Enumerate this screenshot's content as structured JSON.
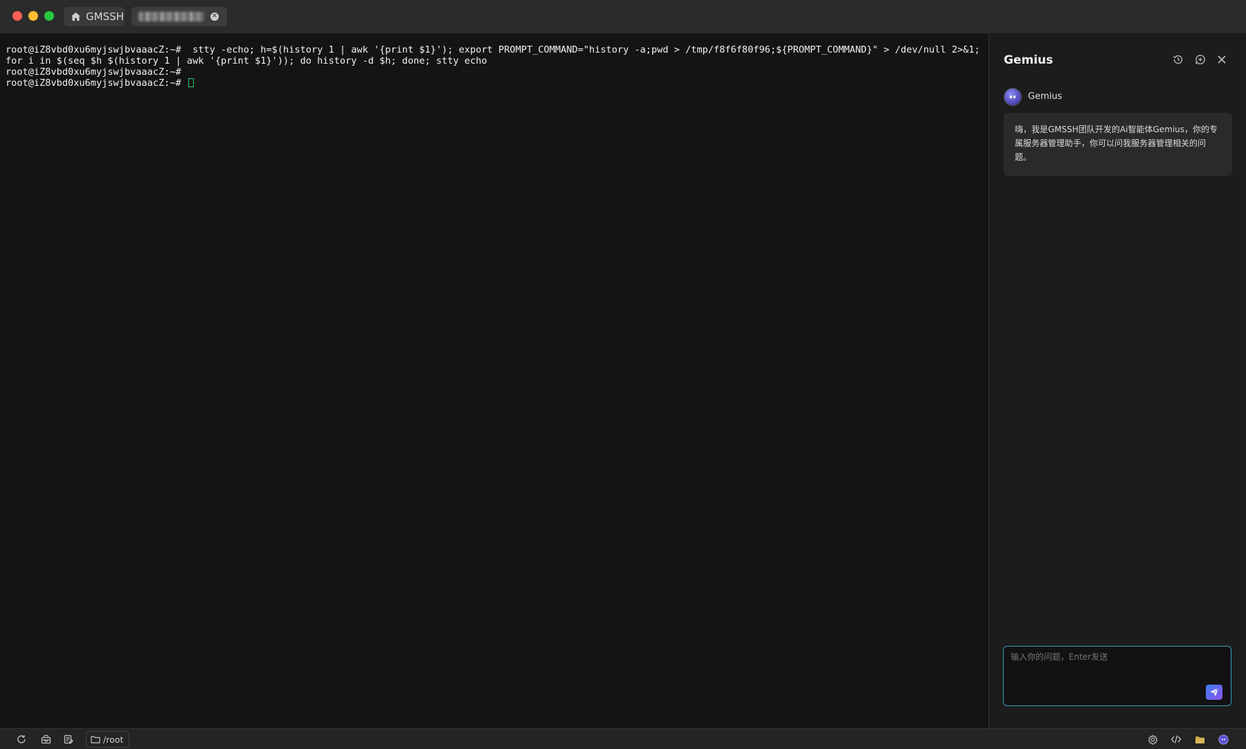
{
  "tabs": [
    {
      "label": "GMSSH",
      "icon": "home-icon"
    },
    {
      "label": "",
      "icon": "close-circle-icon"
    }
  ],
  "terminal": {
    "lines": [
      "root@iZ8vbd0xu6myjswjbvaaacZ:~#  stty -echo; h=$(history 1 | awk '{print $1}'); export PROMPT_COMMAND=\"history -a;pwd > /tmp/f8f6f80f96;${PROMPT_COMMAND}\" > /dev/null 2>&1; for i in $(seq $h $(history 1 | awk '{print $1}')); do history -d $h; done; stty echo",
      "root@iZ8vbd0xu6myjswjbvaaacZ:~#",
      "root@iZ8vbd0xu6myjswjbvaaacZ:~# "
    ]
  },
  "assistant": {
    "title": "Gemius",
    "icons": [
      "history-icon",
      "new-chat-icon",
      "close-icon"
    ],
    "bot_name": "Gemius",
    "greeting": "嗨，我是GMSSH团队开发的Ai智能体Gemius，你的专属服务器管理助手，你可以问我服务器管理相关的问题。",
    "input_placeholder": "输入你的问题，Enter发送",
    "input_value": ""
  },
  "statusbar": {
    "left_icons": [
      "refresh-icon",
      "package-icon",
      "notes-icon"
    ],
    "path": "/root",
    "right_icons": [
      "settings-icon",
      "code-icon",
      "folder-icon",
      "gemius-icon"
    ]
  },
  "colors": {
    "terminal_bg": "#141414",
    "cursor": "#2ecc71",
    "input_border": "#3aa0c8",
    "send_button": "#5b6cf0"
  }
}
